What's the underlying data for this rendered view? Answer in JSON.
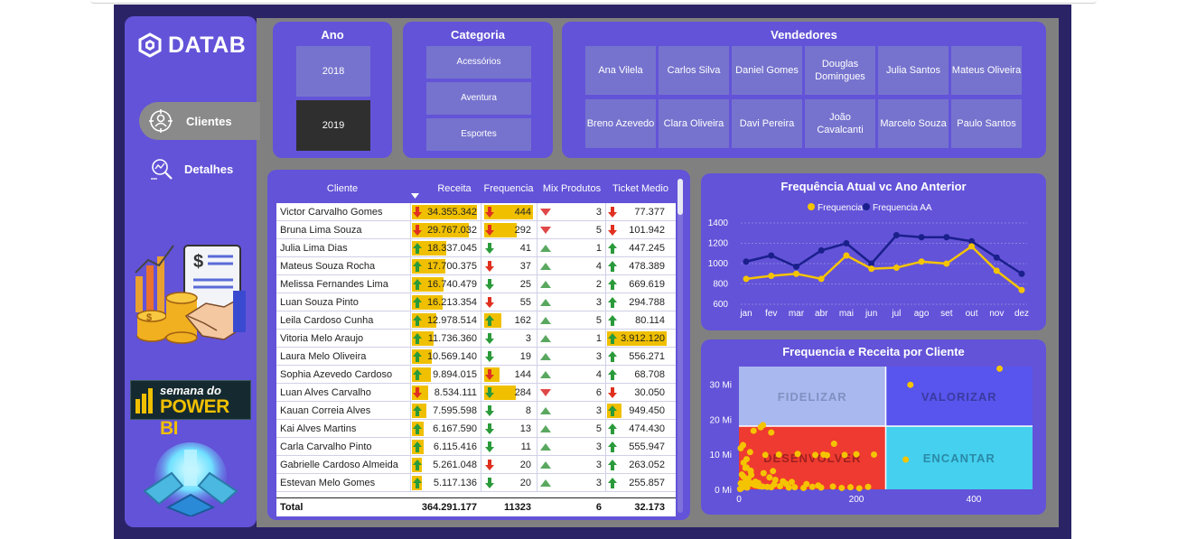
{
  "brand": {
    "name": "DATAB"
  },
  "nav": [
    {
      "label": "Clientes",
      "icon": "target-user-icon",
      "selected": true
    },
    {
      "label": "Detalhes",
      "icon": "search-analytics-icon",
      "selected": false
    }
  ],
  "event_logo": {
    "line1": "semana do",
    "line2": "POWER BI"
  },
  "filters": {
    "ano": {
      "title": "Ano",
      "options": [
        "2018",
        "2019"
      ],
      "selected": "2019"
    },
    "categoria": {
      "title": "Categoria",
      "options": [
        "Acessórios",
        "Aventura",
        "Esportes"
      ]
    },
    "vendedores": {
      "title": "Vendedores",
      "options": [
        "Ana Vilela",
        "Carlos Silva",
        "Daniel Gomes",
        "Douglas Domingues",
        "Julia Santos",
        "Mateus Oliveira",
        "Breno Azevedo",
        "Clara Oliveira",
        "Davi Pereira",
        "João Cavalcanti",
        "Marcelo Souza",
        "Paulo Santos"
      ]
    }
  },
  "table": {
    "columns": [
      "Cliente",
      "Receita",
      "Frequencia",
      "Mix Produtos",
      "Ticket Medio"
    ],
    "sort_column": "Receita",
    "rows": [
      {
        "cliente": "Victor Carvalho Gomes",
        "receita": "34.355.342",
        "receita_frac": 1.0,
        "receita_dir": "down",
        "freq": "444",
        "freq_frac": 1.0,
        "freq_dir": "down",
        "mix": "3",
        "mix_dir": "down-tri",
        "ticket": "77.377",
        "ticket_frac": 0,
        "ticket_dir": "down"
      },
      {
        "cliente": "Bruna Lima Souza",
        "receita": "29.767.032",
        "receita_frac": 0.87,
        "receita_dir": "down",
        "freq": "292",
        "freq_frac": 0.66,
        "freq_dir": "down",
        "mix": "5",
        "mix_dir": "down-tri",
        "ticket": "101.942",
        "ticket_frac": 0,
        "ticket_dir": "down"
      },
      {
        "cliente": "Julia Lima Dias",
        "receita": "18.337.045",
        "receita_frac": 0.53,
        "receita_dir": "up",
        "freq": "41",
        "freq_frac": 0,
        "freq_dir": "down-green",
        "mix": "1",
        "mix_dir": "up-tri",
        "ticket": "447.245",
        "ticket_frac": 0,
        "ticket_dir": "up"
      },
      {
        "cliente": "Mateus Souza Rocha",
        "receita": "17.700.375",
        "receita_frac": 0.51,
        "receita_dir": "up",
        "freq": "37",
        "freq_frac": 0,
        "freq_dir": "down",
        "mix": "4",
        "mix_dir": "up-tri",
        "ticket": "478.389",
        "ticket_frac": 0,
        "ticket_dir": "up"
      },
      {
        "cliente": "Melissa Fernandes Lima",
        "receita": "16.740.479",
        "receita_frac": 0.49,
        "receita_dir": "up",
        "freq": "25",
        "freq_frac": 0,
        "freq_dir": "down-green",
        "mix": "2",
        "mix_dir": "up-tri",
        "ticket": "669.619",
        "ticket_frac": 0,
        "ticket_dir": "up"
      },
      {
        "cliente": "Luan Souza Pinto",
        "receita": "16.213.354",
        "receita_frac": 0.47,
        "receita_dir": "up",
        "freq": "55",
        "freq_frac": 0,
        "freq_dir": "down",
        "mix": "3",
        "mix_dir": "up-tri",
        "ticket": "294.788",
        "ticket_frac": 0,
        "ticket_dir": "up"
      },
      {
        "cliente": "Leila Cardoso Cunha",
        "receita": "12.978.514",
        "receita_frac": 0.38,
        "receita_dir": "up",
        "freq": "162",
        "freq_frac": 0.36,
        "freq_dir": "up",
        "mix": "5",
        "mix_dir": "up-tri",
        "ticket": "80.114",
        "ticket_frac": 0,
        "ticket_dir": "up"
      },
      {
        "cliente": "Vitoria Melo Araujo",
        "receita": "11.736.360",
        "receita_frac": 0.34,
        "receita_dir": "up",
        "freq": "3",
        "freq_frac": 0,
        "freq_dir": "down-green",
        "mix": "1",
        "mix_dir": "up-tri",
        "ticket": "3.912.120",
        "ticket_frac": 1.0,
        "ticket_dir": "up"
      },
      {
        "cliente": "Laura Melo Oliveira",
        "receita": "10.569.140",
        "receita_frac": 0.31,
        "receita_dir": "up",
        "freq": "19",
        "freq_frac": 0,
        "freq_dir": "down-green",
        "mix": "3",
        "mix_dir": "up-tri",
        "ticket": "556.271",
        "ticket_frac": 0,
        "ticket_dir": "up"
      },
      {
        "cliente": "Sophia Azevedo Cardoso",
        "receita": "9.894.015",
        "receita_frac": 0.29,
        "receita_dir": "up",
        "freq": "144",
        "freq_frac": 0.32,
        "freq_dir": "down",
        "mix": "4",
        "mix_dir": "up-tri",
        "ticket": "68.708",
        "ticket_frac": 0,
        "ticket_dir": "up"
      },
      {
        "cliente": "Luan Alves Carvalho",
        "receita": "8.534.111",
        "receita_frac": 0.25,
        "receita_dir": "down",
        "freq": "284",
        "freq_frac": 0.64,
        "freq_dir": "down-green",
        "mix": "6",
        "mix_dir": "down-tri",
        "ticket": "30.050",
        "ticket_frac": 0,
        "ticket_dir": "down"
      },
      {
        "cliente": "Kauan Correia Alves",
        "receita": "7.595.598",
        "receita_frac": 0.22,
        "receita_dir": "up",
        "freq": "8",
        "freq_frac": 0,
        "freq_dir": "down-green",
        "mix": "3",
        "mix_dir": "up-tri",
        "ticket": "949.450",
        "ticket_frac": 0.24,
        "ticket_dir": "up"
      },
      {
        "cliente": "Kai Alves Martins",
        "receita": "6.167.590",
        "receita_frac": 0.18,
        "receita_dir": "up",
        "freq": "13",
        "freq_frac": 0,
        "freq_dir": "down-green",
        "mix": "5",
        "mix_dir": "up-tri",
        "ticket": "474.430",
        "ticket_frac": 0,
        "ticket_dir": "up"
      },
      {
        "cliente": "Carla Carvalho Pinto",
        "receita": "6.115.416",
        "receita_frac": 0.18,
        "receita_dir": "up",
        "freq": "11",
        "freq_frac": 0,
        "freq_dir": "down-green",
        "mix": "3",
        "mix_dir": "up-tri",
        "ticket": "555.947",
        "ticket_frac": 0,
        "ticket_dir": "up"
      },
      {
        "cliente": "Gabrielle Cardoso Almeida",
        "receita": "5.261.048",
        "receita_frac": 0.15,
        "receita_dir": "up",
        "freq": "20",
        "freq_frac": 0,
        "freq_dir": "down",
        "mix": "3",
        "mix_dir": "up-tri",
        "ticket": "263.052",
        "ticket_frac": 0,
        "ticket_dir": "up"
      },
      {
        "cliente": "Estevan Melo Gomes",
        "receita": "5.117.136",
        "receita_frac": 0.15,
        "receita_dir": "up",
        "freq": "20",
        "freq_frac": 0,
        "freq_dir": "down-green",
        "mix": "3",
        "mix_dir": "up-tri",
        "ticket": "255.857",
        "ticket_frac": 0,
        "ticket_dir": "up"
      }
    ],
    "total": {
      "label": "Total",
      "receita": "364.291.177",
      "freq": "11323",
      "mix": "6",
      "ticket": "32.173"
    }
  },
  "colors": {
    "panel": "#6353d8",
    "bar": "#f0c000",
    "up": "#2a9a3a",
    "down": "#e03020",
    "series1": "#f5c400",
    "series2": "#1a1f8c"
  },
  "chart_data": [
    {
      "type": "line",
      "title": "Frequência Atual vc Ano Anterior",
      "categories": [
        "jan",
        "fev",
        "mar",
        "abr",
        "mai",
        "jun",
        "jul",
        "ago",
        "set",
        "out",
        "nov",
        "dez"
      ],
      "series": [
        {
          "name": "Frequencia",
          "color": "#f5c400",
          "values": [
            850,
            880,
            900,
            850,
            1080,
            950,
            960,
            1020,
            1000,
            1170,
            930,
            740
          ]
        },
        {
          "name": "Frequencia AA",
          "color": "#1a1f8c",
          "values": [
            1020,
            1080,
            970,
            1130,
            1200,
            1000,
            1280,
            1260,
            1260,
            1220,
            1060,
            900
          ]
        }
      ],
      "yticks": [
        "600",
        "800",
        "1000",
        "1200",
        "1400"
      ],
      "ylim": [
        600,
        1400
      ],
      "legend": "top-center",
      "grid": true
    },
    {
      "type": "scatter",
      "title": "Frequencia e Receita por Cliente",
      "xticks": [
        "0",
        "200",
        "400"
      ],
      "yticks": [
        "0 Mi",
        "10 Mi",
        "20 Mi",
        "30 Mi"
      ],
      "xlim": [
        0,
        500
      ],
      "ylim": [
        0,
        35
      ],
      "quadrants": [
        {
          "label": "FIDELIZAR",
          "color": "#aab8f0",
          "text_color": "#8090c0"
        },
        {
          "label": "VALORIZAR",
          "color": "#5855ee",
          "text_color": "#3a3aa0"
        },
        {
          "label": "DESENVOLVER",
          "color": "#ee3a30",
          "text_color": "#a02020"
        },
        {
          "label": "ENCANTAR",
          "color": "#44d0ee",
          "text_color": "#2a8aa8"
        }
      ],
      "points": [
        [
          444,
          34.4
        ],
        [
          292,
          29.8
        ],
        [
          162,
          13.0
        ],
        [
          144,
          9.9
        ],
        [
          284,
          8.5
        ],
        [
          55,
          16.2
        ],
        [
          41,
          18.3
        ],
        [
          37,
          17.7
        ],
        [
          25,
          16.7
        ],
        [
          19,
          10.6
        ],
        [
          20,
          5.3
        ],
        [
          20,
          5.1
        ],
        [
          13,
          6.2
        ],
        [
          11,
          6.1
        ],
        [
          8,
          7.6
        ],
        [
          3,
          11.7
        ],
        [
          5,
          4.2
        ],
        [
          8,
          3.6
        ],
        [
          12,
          2.9
        ],
        [
          15,
          2.4
        ],
        [
          18,
          1.9
        ],
        [
          22,
          1.6
        ],
        [
          26,
          1.3
        ],
        [
          30,
          1.1
        ],
        [
          35,
          0.9
        ],
        [
          40,
          0.8
        ],
        [
          48,
          0.7
        ],
        [
          55,
          0.6
        ],
        [
          6,
          1.2
        ],
        [
          9,
          0.7
        ],
        [
          14,
          0.5
        ],
        [
          4,
          0.3
        ],
        [
          10,
          2.0
        ],
        [
          16,
          3.0
        ],
        [
          28,
          2.2
        ],
        [
          33,
          1.8
        ],
        [
          60,
          1.4
        ],
        [
          70,
          0.9
        ],
        [
          85,
          0.5
        ],
        [
          95,
          0.6
        ],
        [
          110,
          0.4
        ],
        [
          125,
          0.7
        ],
        [
          140,
          0.5
        ],
        [
          160,
          0.8
        ],
        [
          175,
          0.4
        ],
        [
          190,
          0.6
        ],
        [
          205,
          0.3
        ],
        [
          220,
          0.7
        ],
        [
          75,
          2.3
        ],
        [
          52,
          3.4
        ],
        [
          45,
          9.8
        ],
        [
          68,
          9.9
        ],
        [
          100,
          10.1
        ],
        [
          130,
          9.8
        ],
        [
          150,
          9.7
        ],
        [
          180,
          9.8
        ],
        [
          200,
          10.0
        ],
        [
          230,
          9.9
        ],
        [
          7,
          12.6
        ],
        [
          13,
          8.6
        ],
        [
          2,
          0.1
        ],
        [
          3,
          1.7
        ],
        [
          21,
          4.1
        ],
        [
          42,
          4.6
        ],
        [
          58,
          5.2
        ],
        [
          62,
          2.7
        ],
        [
          80,
          1.6
        ],
        [
          90,
          2.1
        ],
        [
          115,
          1.5
        ],
        [
          135,
          1.1
        ]
      ]
    }
  ]
}
